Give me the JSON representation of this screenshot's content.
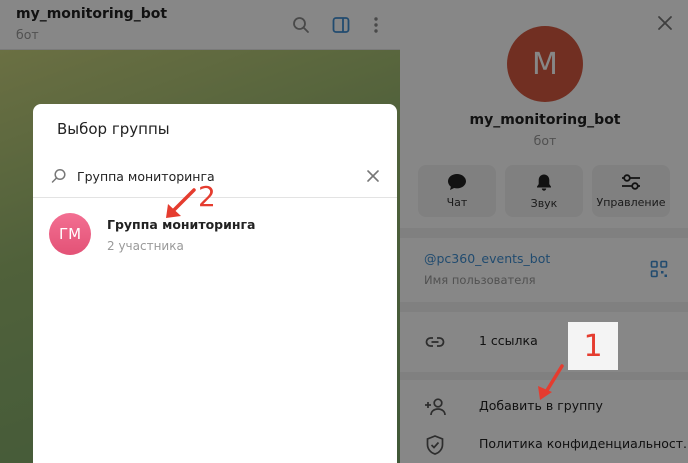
{
  "chat": {
    "title": "my_monitoring_bot",
    "subtitle": "бот",
    "icons": {
      "search": "search-icon",
      "sidebar": "sidebar-toggle-icon",
      "more": "more-vert-icon"
    }
  },
  "profile": {
    "avatar_letter": "M",
    "avatar_color": "#d65a41",
    "name": "my_monitoring_bot",
    "subtitle": "бот",
    "actions": [
      {
        "label": "Чат",
        "icon": "chat-icon"
      },
      {
        "label": "Звук",
        "icon": "bell-icon"
      },
      {
        "label": "Управление",
        "icon": "sliders-icon"
      }
    ],
    "username": "@pc360_events_bot",
    "username_label": "Имя пользователя",
    "links_label": "1 ссылка",
    "add_to_group_label": "Добавить в группу",
    "privacy_label": "Политика конфиденциальност..."
  },
  "modal": {
    "title": "Выбор группы",
    "search": {
      "value": "Группа мониторинга",
      "placeholder": ""
    },
    "results": [
      {
        "initials": "ГМ",
        "name": "Группа мониторинга",
        "subtitle": "2 участника"
      }
    ]
  },
  "annotations": {
    "step1": "1",
    "step2": "2",
    "color": "#e53c2f"
  },
  "colors": {
    "accent": "#3f8fd2",
    "link": "#3f8fd2"
  }
}
